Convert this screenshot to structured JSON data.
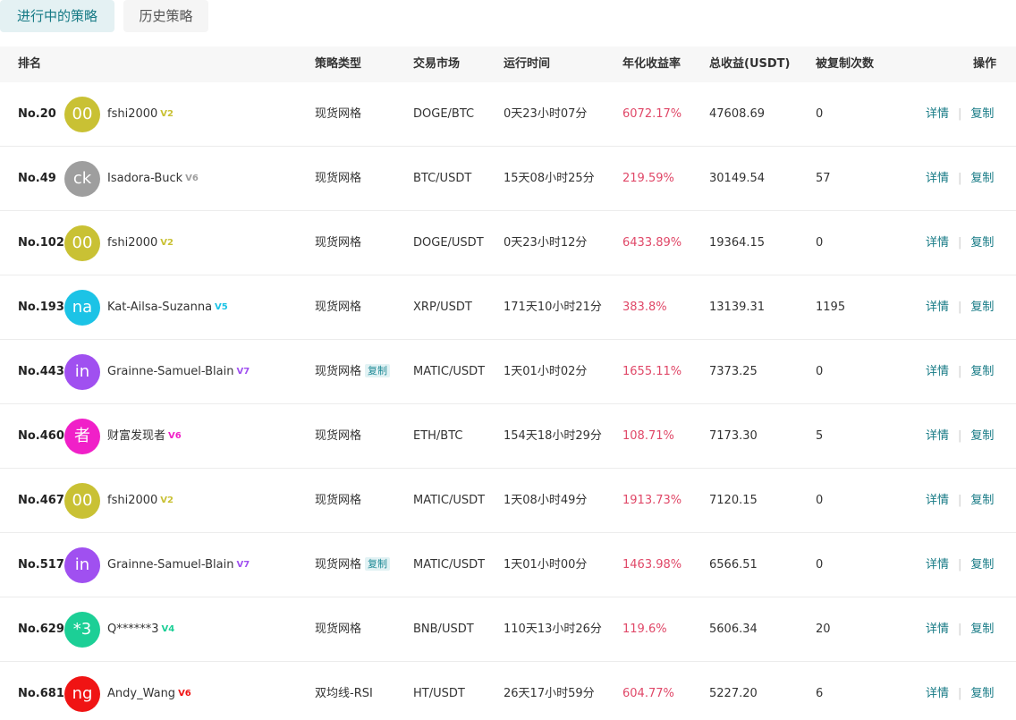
{
  "tabs": {
    "active": "进行中的策略",
    "inactive": "历史策略"
  },
  "columns": {
    "rank": "排名",
    "type": "策略类型",
    "market": "交易市场",
    "runtime": "运行时间",
    "rate": "年化收益率",
    "profit": "总收益(USDT)",
    "copies": "被复制次数",
    "ops": "操作"
  },
  "actions": {
    "detail": "详情",
    "copy": "复制",
    "separator": "|"
  },
  "rows": [
    {
      "rank": "No.20",
      "avatar": "00",
      "avatar_color": "#c9c134",
      "name": "fshi2000",
      "badge": "V2",
      "badge_color": "#c9c134",
      "type": "现货网格",
      "tag": "",
      "market": "DOGE/BTC",
      "runtime": "0天23小时07分",
      "rate": "6072.17%",
      "profit": "47608.69",
      "copies": "0"
    },
    {
      "rank": "No.49",
      "avatar": "ck",
      "avatar_color": "#9e9e9e",
      "name": "Isadora-Buck",
      "badge": "V6",
      "badge_color": "#9e9e9e",
      "type": "现货网格",
      "tag": "",
      "market": "BTC/USDT",
      "runtime": "15天08小时25分",
      "rate": "219.59%",
      "profit": "30149.54",
      "copies": "57"
    },
    {
      "rank": "No.102",
      "avatar": "00",
      "avatar_color": "#c9c134",
      "name": "fshi2000",
      "badge": "V2",
      "badge_color": "#c9c134",
      "type": "现货网格",
      "tag": "",
      "market": "DOGE/USDT",
      "runtime": "0天23小时12分",
      "rate": "6433.89%",
      "profit": "19364.15",
      "copies": "0"
    },
    {
      "rank": "No.193",
      "avatar": "na",
      "avatar_color": "#1cc3e6",
      "name": "Kat-Ailsa-Suzanna",
      "badge": "V5",
      "badge_color": "#1cc3e6",
      "type": "现货网格",
      "tag": "",
      "market": "XRP/USDT",
      "runtime": "171天10小时21分",
      "rate": "383.8%",
      "profit": "13139.31",
      "copies": "1195"
    },
    {
      "rank": "No.443",
      "avatar": "in",
      "avatar_color": "#a050f0",
      "name": "Grainne-Samuel-Blain",
      "badge": "V7",
      "badge_color": "#a050f0",
      "type": "现货网格",
      "tag": "复制",
      "market": "MATIC/USDT",
      "runtime": "1天01小时02分",
      "rate": "1655.11%",
      "profit": "7373.25",
      "copies": "0"
    },
    {
      "rank": "No.460",
      "avatar": "者",
      "avatar_color": "#f020c8",
      "name": "财富发现者",
      "badge": "V6",
      "badge_color": "#f020c8",
      "type": "现货网格",
      "tag": "",
      "market": "ETH/BTC",
      "runtime": "154天18小时29分",
      "rate": "108.71%",
      "profit": "7173.30",
      "copies": "5"
    },
    {
      "rank": "No.467",
      "avatar": "00",
      "avatar_color": "#c9c134",
      "name": "fshi2000",
      "badge": "V2",
      "badge_color": "#c9c134",
      "type": "现货网格",
      "tag": "",
      "market": "MATIC/USDT",
      "runtime": "1天08小时49分",
      "rate": "1913.73%",
      "profit": "7120.15",
      "copies": "0"
    },
    {
      "rank": "No.517",
      "avatar": "in",
      "avatar_color": "#a050f0",
      "name": "Grainne-Samuel-Blain",
      "badge": "V7",
      "badge_color": "#a050f0",
      "type": "现货网格",
      "tag": "复制",
      "market": "MATIC/USDT",
      "runtime": "1天01小时00分",
      "rate": "1463.98%",
      "profit": "6566.51",
      "copies": "0"
    },
    {
      "rank": "No.629",
      "avatar": "*3",
      "avatar_color": "#1ccf96",
      "name": "Q******3",
      "badge": "V4",
      "badge_color": "#1ccf96",
      "type": "现货网格",
      "tag": "",
      "market": "BNB/USDT",
      "runtime": "110天13小时26分",
      "rate": "119.6%",
      "profit": "5606.34",
      "copies": "20"
    },
    {
      "rank": "No.681",
      "avatar": "ng",
      "avatar_color": "#f01414",
      "name": "Andy_Wang",
      "badge": "V6",
      "badge_color": "#f01414",
      "type": "双均线-RSI",
      "tag": "",
      "market": "HT/USDT",
      "runtime": "26天17小时59分",
      "rate": "604.77%",
      "profit": "5227.20",
      "copies": "6"
    }
  ]
}
